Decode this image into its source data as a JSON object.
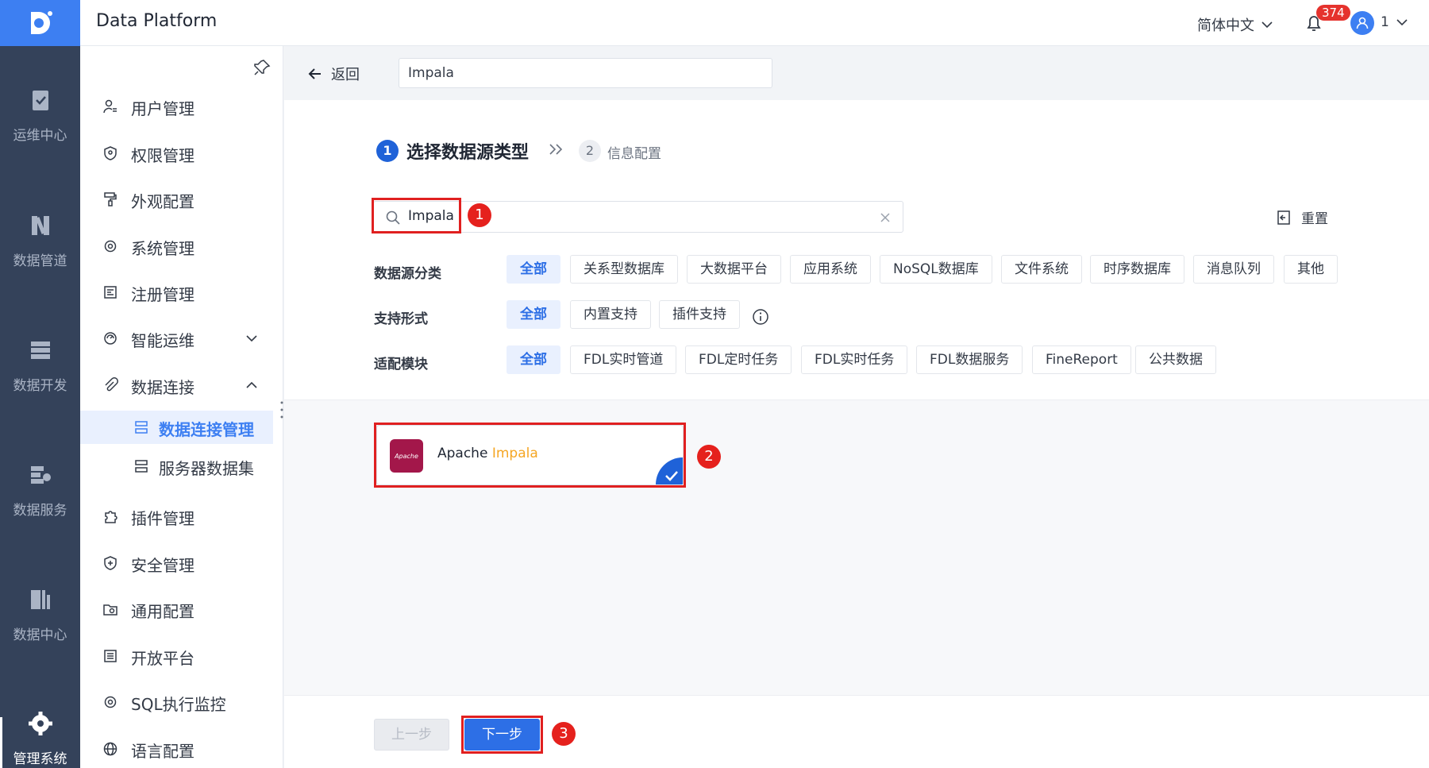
{
  "header": {
    "app_title": "Data Platform",
    "language": "简体中文",
    "notification_count": "374",
    "user_name": "1",
    "accent_color": "#3d7ff2"
  },
  "rail": {
    "items": [
      {
        "label": "运维中心",
        "icon": "clipboard-check-icon"
      },
      {
        "label": "数据管道",
        "icon": "pipeline-icon"
      },
      {
        "label": "数据开发",
        "icon": "data-dev-icon"
      },
      {
        "label": "数据服务",
        "icon": "data-service-icon"
      },
      {
        "label": "数据中心",
        "icon": "data-center-icon"
      },
      {
        "label": "管理系统",
        "icon": "gear-icon"
      }
    ]
  },
  "sidebar": {
    "items": [
      {
        "label": "用户管理",
        "icon": "user-manage-icon"
      },
      {
        "label": "权限管理",
        "icon": "permission-shield-icon"
      },
      {
        "label": "外观配置",
        "icon": "paint-roller-icon"
      },
      {
        "label": "系统管理",
        "icon": "gear-icon"
      },
      {
        "label": "注册管理",
        "icon": "register-icon"
      },
      {
        "label": "智能运维",
        "icon": "smart-ops-icon"
      },
      {
        "label": "数据连接",
        "icon": "paperclip-icon"
      },
      {
        "label": "插件管理",
        "icon": "puzzle-icon"
      },
      {
        "label": "安全管理",
        "icon": "security-shield-icon"
      },
      {
        "label": "通用配置",
        "icon": "folder-gear-icon"
      },
      {
        "label": "开放平台",
        "icon": "list-icon"
      },
      {
        "label": "SQL执行监控",
        "icon": "gear-icon"
      },
      {
        "label": "语言配置",
        "icon": "globe-icon"
      }
    ],
    "sub_items": [
      {
        "label": "数据连接管理",
        "icon": "connection-manage-icon"
      },
      {
        "label": "服务器数据集",
        "icon": "server-dataset-icon"
      }
    ]
  },
  "topbar": {
    "back_label": "返回",
    "name_value": "Impala"
  },
  "steps": {
    "step1_num": "1",
    "step1_label": "选择数据源类型",
    "step2_num": "2",
    "step2_label": "信息配置"
  },
  "search": {
    "value": "Impala"
  },
  "reset_label": "重置",
  "filters": {
    "category": {
      "label": "数据源分类",
      "options": [
        "全部",
        "关系型数据库",
        "大数据平台",
        "应用系统",
        "NoSQL数据库",
        "文件系统",
        "时序数据库",
        "消息队列",
        "其他"
      ]
    },
    "support": {
      "label": "支持形式",
      "options": [
        "全部",
        "内置支持",
        "插件支持"
      ]
    },
    "module": {
      "label": "适配模块",
      "options": [
        "全部",
        "FDL实时管道",
        "FDL定时任务",
        "FDL实时任务",
        "FDL数据服务",
        "FineReport",
        "公共数据"
      ]
    }
  },
  "result_card": {
    "name_prefix": "Apache ",
    "name_highlight": "Impala",
    "logo_text": "Apache"
  },
  "footer": {
    "prev_label": "上一步",
    "next_label": "下一步"
  },
  "annotations": [
    "1",
    "2",
    "3"
  ]
}
